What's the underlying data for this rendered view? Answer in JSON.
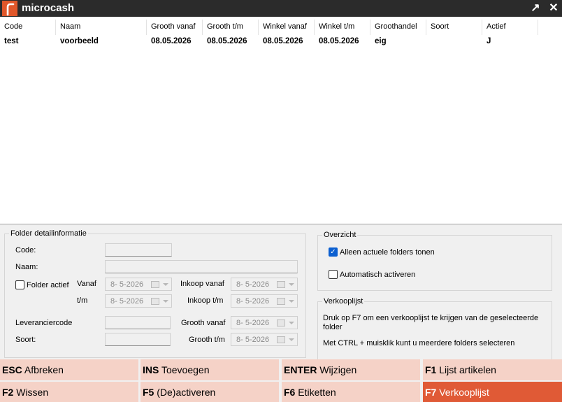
{
  "app": {
    "title": "microcash"
  },
  "titlebar": {
    "restore_glyph": "↗",
    "close_glyph": "✕"
  },
  "grid": {
    "columns": [
      "Code",
      "Naam",
      "Grooth vanaf",
      "Grooth t/m",
      "Winkel vanaf",
      "Winkel t/m",
      "Groothandel",
      "Soort",
      "Actief"
    ],
    "rows": [
      [
        "test",
        "voorbeeld",
        "08.05.2026",
        "08.05.2026",
        "08.05.2026",
        "08.05.2026",
        "eig",
        "",
        "J"
      ]
    ]
  },
  "detail": {
    "legend": "Folder detailinformatie",
    "code_label": "Code:",
    "naam_label": "Naam:",
    "folder_actief_label": "Folder actief",
    "vanaf_label": "Vanaf",
    "tm_label": "t/m",
    "inkoop_vanaf_label": "Inkoop vanaf",
    "inkoop_tm_label": "Inkoop t/m",
    "leverancierscode_label": "Leveranciercode",
    "soort_label": "Soort:",
    "grooth_vanaf_label": "Grooth vanaf",
    "grooth_tm_label": "Grooth t/m",
    "vanaf_value": "8-  5-2026",
    "tm_value": "8-  5-2026",
    "inkoop_vanaf_value": "8-  5-2026",
    "inkoop_tm_value": "8-  5-2026",
    "grooth_vanaf_value": "8-  5-2026",
    "grooth_tm_value": "8-  5-2026"
  },
  "overzicht": {
    "legend": "Overzicht",
    "actuele_label": "Alleen actuele folders tonen",
    "actuele_checked": true,
    "auto_label": "Automatisch activeren",
    "auto_checked": false
  },
  "verkooplijst": {
    "legend": "Verkooplijst",
    "text1": "Druk op F7 om een verkooplijst te krijgen van de geselecteerde folder",
    "text2": "Met CTRL + muisklik kunt u meerdere folders selecteren"
  },
  "fkeys": [
    {
      "key": "ESC",
      "label": "Afbreken"
    },
    {
      "key": "INS",
      "label": "Toevoegen"
    },
    {
      "key": "ENTER",
      "label": "Wijzigen"
    },
    {
      "key": "F1",
      "label": "Lijst artikelen"
    },
    {
      "key": "F2",
      "label": "Wissen"
    },
    {
      "key": "F5",
      "label": "(De)activeren"
    },
    {
      "key": "F6",
      "label": "Etiketten"
    },
    {
      "key": "F7",
      "label": "Verkooplijst"
    }
  ],
  "colors": {
    "accent": "#e05a36",
    "fkey_bg": "#f5d2c7",
    "titlebar": "#2b2b2b"
  }
}
